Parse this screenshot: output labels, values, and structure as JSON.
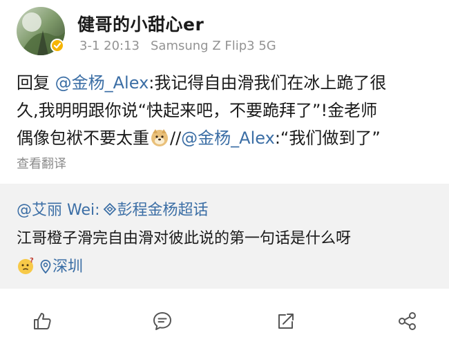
{
  "post": {
    "author": "健哥的小甜心er",
    "timestamp": "3-1 20:13",
    "device": "Samsung Z Flip3 5G",
    "content": {
      "reply_prefix": "回复",
      "mention_1": "@金杨_Alex",
      "line1_text": ":我记得自由滑我们在冰上跪了很",
      "line2_text": "久,我明明跟你说“快起来吧，不要跪拜了”!金老师",
      "line3_text": "偶像包袱不要太重",
      "repost_sep": "//",
      "mention_2": "@金杨_Alex",
      "line3_tail": ":“我们做到了”"
    },
    "translate_label": "查看翻译"
  },
  "repost": {
    "mention": "@艾丽 Wei",
    "colon": ":",
    "supertopic": "彭程金杨超话",
    "text": "江哥橙子滑完自由滑对彼此说的第一句话是什么呀",
    "location": "深圳"
  },
  "icons": {
    "verified": "verified-badge-icon",
    "dog_emoji": "doge-emoji-icon",
    "thinking_emoji": "thinking-emoji-icon",
    "supertopic": "supertopic-icon",
    "location": "location-pin-icon",
    "like": "like-icon",
    "comment": "comment-icon",
    "repost": "repost-icon",
    "share": "share-icon"
  },
  "colors": {
    "link": "#3b6ea5",
    "meta": "#939393",
    "repost_bg": "#f2f2f2",
    "verified": "#f5b400"
  }
}
